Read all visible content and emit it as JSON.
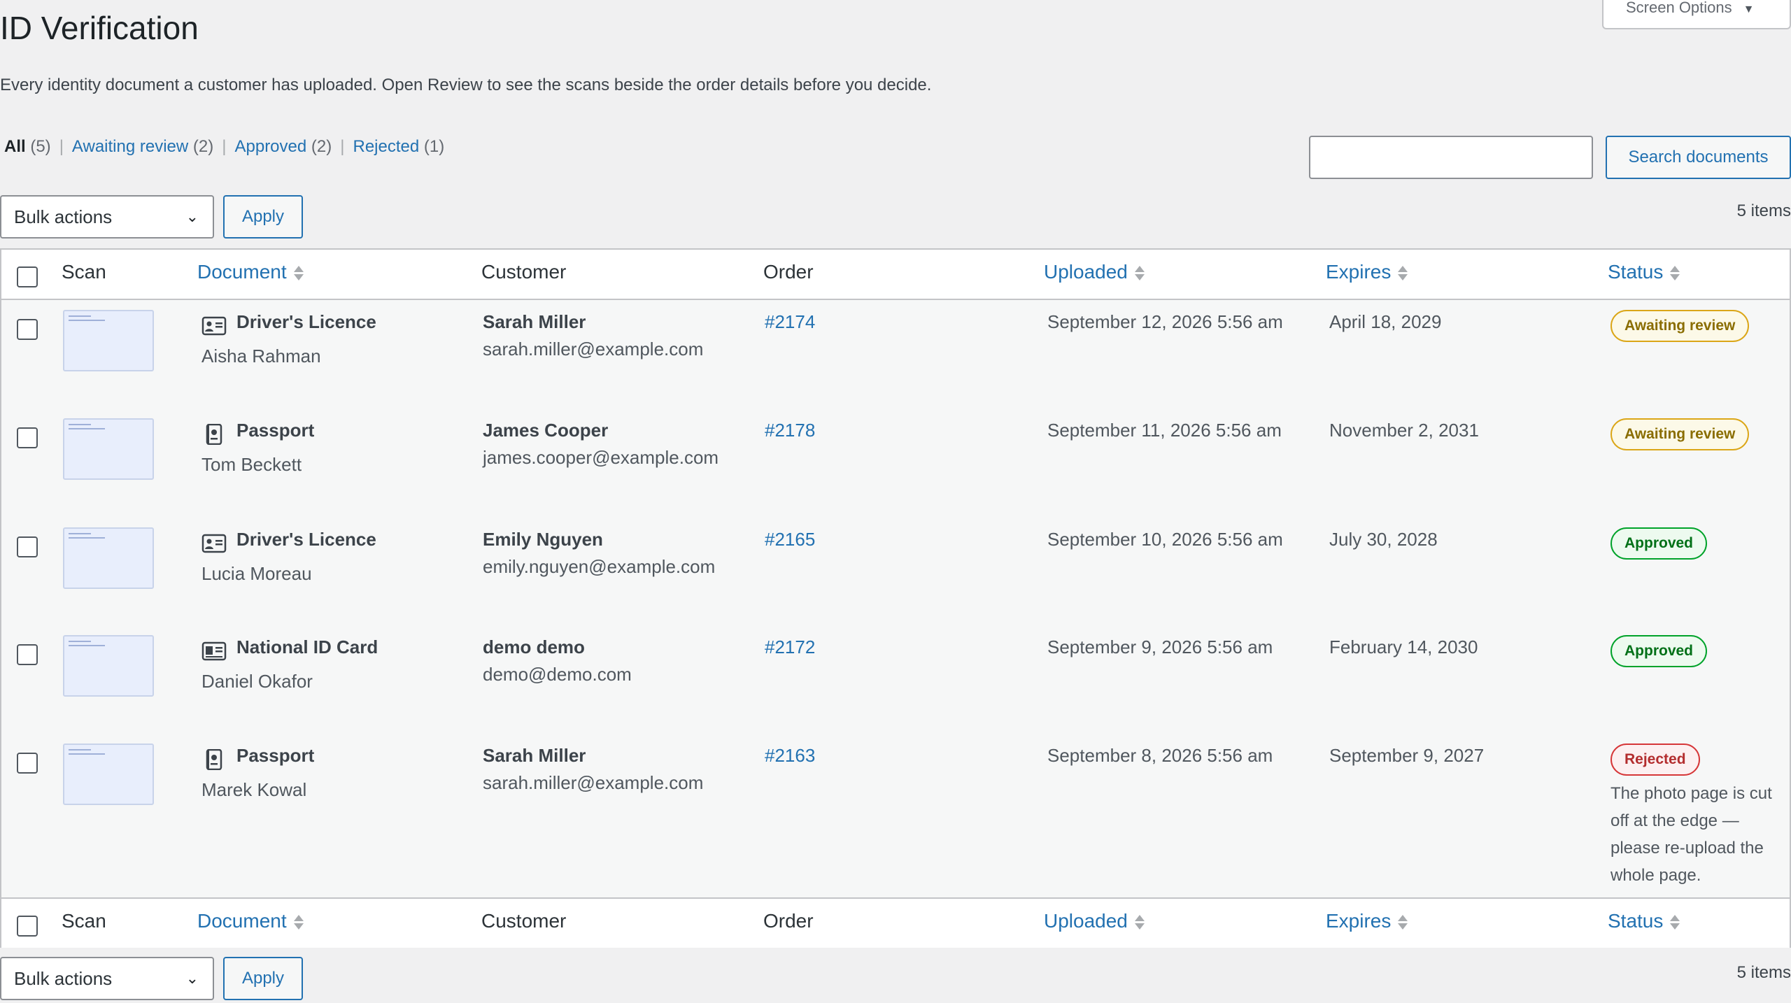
{
  "page": {
    "title": "ID Verification",
    "screen_options": "Screen Options",
    "intro": "Every identity document a customer has uploaded. Open Review to see the scans beside the order details before you decide."
  },
  "filters": [
    {
      "label": "All",
      "count": "(5)",
      "current": true
    },
    {
      "label": "Awaiting review",
      "count": "(2)",
      "current": false
    },
    {
      "label": "Approved",
      "count": "(2)",
      "current": false
    },
    {
      "label": "Rejected",
      "count": "(1)",
      "current": false
    }
  ],
  "search": {
    "placeholder": "",
    "button": "Search documents"
  },
  "bulk": {
    "label": "Bulk actions",
    "apply": "Apply",
    "items": "5 items"
  },
  "columns": {
    "scan": "Scan",
    "document": "Document",
    "customer": "Customer",
    "order": "Order",
    "uploaded": "Uploaded",
    "expires": "Expires",
    "status": "Status"
  },
  "rows": [
    {
      "doc_type": "Driver's Licence",
      "doc_icon": "id-card-icon",
      "holder": "Aisha Rahman",
      "customer": "Sarah Miller",
      "email": "sarah.miller@example.com",
      "order": "#2174",
      "uploaded": "September 12, 2026 5:56 am",
      "expires": "April 18, 2029",
      "status": "Awaiting review",
      "status_kind": "pending",
      "note": ""
    },
    {
      "doc_type": "Passport",
      "doc_icon": "passport-icon",
      "holder": "Tom Beckett",
      "customer": "James Cooper",
      "email": "james.cooper@example.com",
      "order": "#2178",
      "uploaded": "September 11, 2026 5:56 am",
      "expires": "November 2, 2031",
      "status": "Awaiting review",
      "status_kind": "pending",
      "note": ""
    },
    {
      "doc_type": "Driver's Licence",
      "doc_icon": "id-card-icon",
      "holder": "Lucia Moreau",
      "customer": "Emily Nguyen",
      "email": "emily.nguyen@example.com",
      "order": "#2165",
      "uploaded": "September 10, 2026 5:56 am",
      "expires": "July 30, 2028",
      "status": "Approved",
      "status_kind": "approved",
      "note": ""
    },
    {
      "doc_type": "National ID Card",
      "doc_icon": "national-id-icon",
      "holder": "Daniel Okafor",
      "customer": "demo demo",
      "email": "demo@demo.com",
      "order": "#2172",
      "uploaded": "September 9, 2026 5:56 am",
      "expires": "February 14, 2030",
      "status": "Approved",
      "status_kind": "approved",
      "note": ""
    },
    {
      "doc_type": "Passport",
      "doc_icon": "passport-icon",
      "holder": "Marek Kowal",
      "customer": "Sarah Miller",
      "email": "sarah.miller@example.com",
      "order": "#2163",
      "uploaded": "September 8, 2026 5:56 am",
      "expires": "September 9, 2027",
      "status": "Rejected",
      "status_kind": "rejected",
      "note": "The photo page is cut off at the edge — please re-upload the whole page."
    }
  ]
}
